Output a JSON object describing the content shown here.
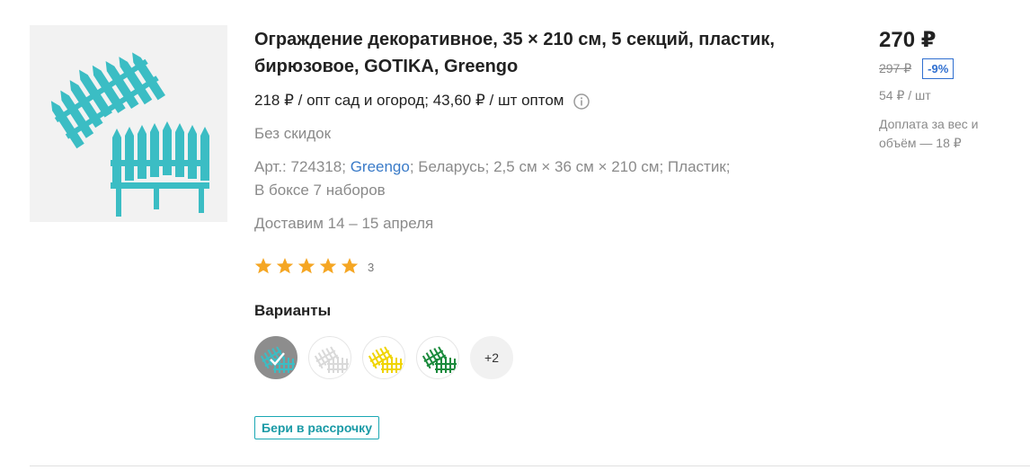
{
  "product": {
    "title": "Ограждение декоративное, 35 × 210 см, 5 секций, пластик, бирюзовое, GOTIKA, Greengo",
    "wholesale_text": "218 ₽ / опт сад и огород; 43,60 ₽ / шт оптом",
    "discount_note": "Без скидок",
    "attrs": {
      "article": "Арт.: 724318;",
      "brand": "Greengo",
      "rest": "; Беларусь; 2,5 см × 36 см × 210 см; Пластик;",
      "box": "В боксе 7 наборов"
    },
    "delivery": "Доставим 14 – 15 апреля",
    "rating": {
      "stars": 5,
      "count": "3",
      "star_color": "#f5a623"
    },
    "image_color": "#3bbdc4"
  },
  "variants": {
    "title": "Варианты",
    "items": [
      {
        "color": "#3bbdc4",
        "icon": "fence-turquoise-icon",
        "selected": true
      },
      {
        "color": "#ededed",
        "icon": "fence-white-icon",
        "selected": false
      },
      {
        "color": "#f0d400",
        "icon": "fence-yellow-icon",
        "selected": false
      },
      {
        "color": "#1a8a3c",
        "icon": "fence-green-icon",
        "selected": false
      }
    ],
    "more_label": "+2"
  },
  "installment_label": "Бери в рассрочку",
  "pricing": {
    "price": "270 ₽",
    "old_price": "297 ₽",
    "discount": "-9%",
    "unit_price": "54 ₽ / шт",
    "surcharge": "Доплата за вес и объём — 18 ₽"
  },
  "colors": {
    "link": "#3a7bc8",
    "accent": "#1aa8b4",
    "badge": "#2f6fd0"
  }
}
